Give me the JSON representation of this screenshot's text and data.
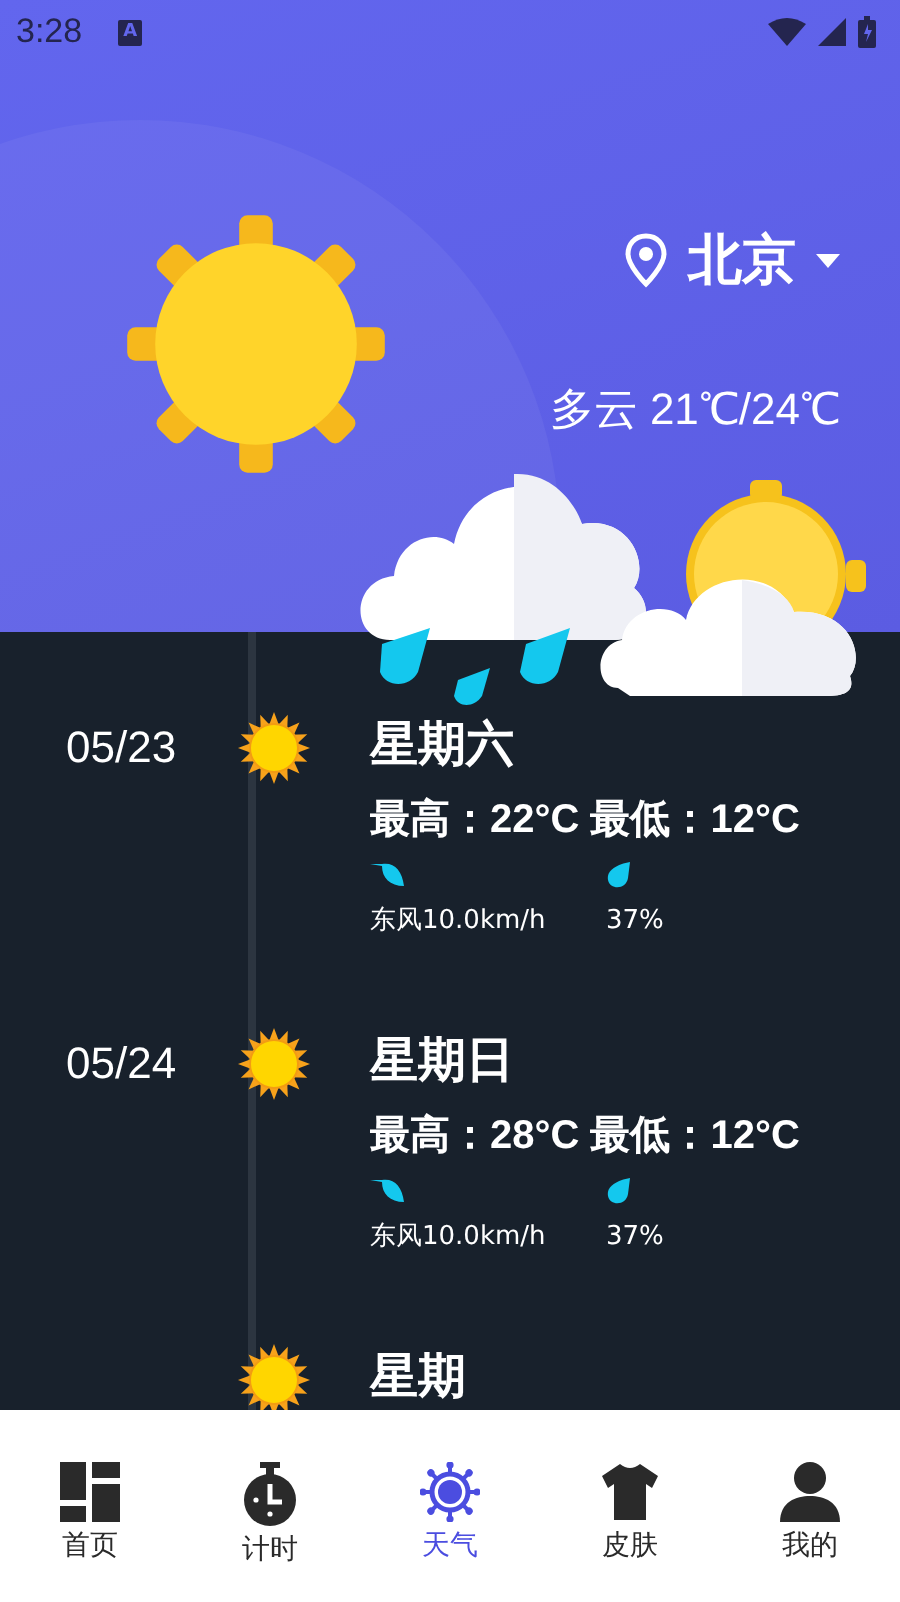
{
  "status_bar": {
    "time": "3:28",
    "notification_letter": "A"
  },
  "location": {
    "city": "北京"
  },
  "current": {
    "condition": "多云",
    "temperature": "21℃/24℃"
  },
  "days": [
    {
      "date": "05/23",
      "weekday": "星期六",
      "high_low": "最高：22°C 最低：12°C",
      "wind": "东风10.0km/h",
      "humidity": "37%"
    },
    {
      "date": "05/24",
      "weekday": "星期日",
      "high_low": "最高：28°C 最低：12°C",
      "wind": "东风10.0km/h",
      "humidity": "37%"
    },
    {
      "weekday": "星期"
    }
  ],
  "tabs": [
    {
      "kind": "home",
      "label": "首页",
      "selected": false
    },
    {
      "kind": "timer",
      "label": "计时",
      "selected": false
    },
    {
      "kind": "weather",
      "label": "天气",
      "selected": true
    },
    {
      "kind": "skin",
      "label": "皮肤",
      "selected": false
    },
    {
      "kind": "me",
      "label": "我的",
      "selected": false
    }
  ]
}
